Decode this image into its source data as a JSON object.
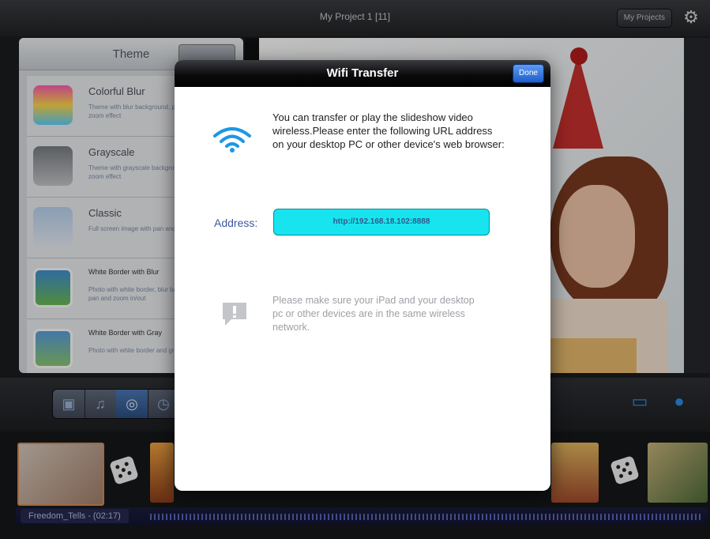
{
  "topbar": {
    "title": "My Project 1 [11]",
    "my_projects_label": "My Projects",
    "settings_icon": "gear-icon"
  },
  "theme_panel": {
    "title": "Theme",
    "items": [
      {
        "name": "Colorful Blur",
        "desc": "Theme with blur background, pan effect and zoom effect"
      },
      {
        "name": "Grayscale",
        "desc": "Theme with grayscale background and without zoom effect"
      },
      {
        "name": "Classic",
        "desc": "Full screen image with pan and zoom effect"
      },
      {
        "name": "White Border with Blur",
        "desc": "Photo with white border, blur background, no pan and zoom in/out"
      },
      {
        "name": "White Border with Gray",
        "desc": "Photo with white border and gray background"
      }
    ]
  },
  "timeline": {
    "audio_label": "Freedom_Tells - (02:17)"
  },
  "modal": {
    "title": "Wifi Transfer",
    "done_label": "Done",
    "intro": "You can transfer or play the slideshow video wireless.Please enter the following URL address on your desktop PC or other device's web browser:",
    "address_label": "Address:",
    "address_value": "http://192.168.18.102:8888",
    "note": "Please make sure your iPad and your desktop pc or other devices are in the same wireless network.",
    "wifi_icon": "wifi-icon",
    "warning_icon": "exclamation-speech-bubble-icon"
  },
  "colors": {
    "accent_blue": "#1c5ecb",
    "address_box": "#17e4ef",
    "address_text": "#2c5d8c",
    "address_label": "#3d5a9e"
  }
}
